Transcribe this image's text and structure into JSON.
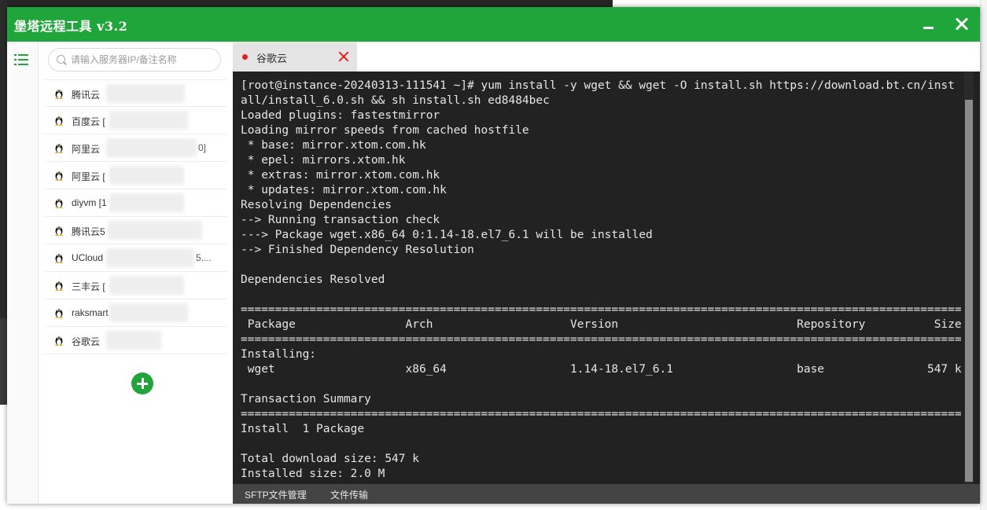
{
  "window": {
    "title": "堡塔远程工具 v3.2",
    "accent_color": "#20a53a"
  },
  "sidebar": {
    "menu_icon": "list-icon",
    "search": {
      "placeholder": "请输入服务器IP/备注名称",
      "value": ""
    },
    "servers": [
      {
        "name": "腾讯云",
        "tail": ""
      },
      {
        "name": "百度云 [",
        "tail": ""
      },
      {
        "name": "阿里云",
        "tail": "0]"
      },
      {
        "name": "阿里云 [",
        "tail": ""
      },
      {
        "name": "diyvm [1",
        "tail": ""
      },
      {
        "name": "腾讯云5",
        "tail": ""
      },
      {
        "name": "UCloud",
        "tail": "5...."
      },
      {
        "name": "三丰云 [",
        "tail": ""
      },
      {
        "name": "raksmart",
        "tail": ""
      },
      {
        "name": "谷歌云",
        "tail": ""
      }
    ],
    "server_icon": "linux-penguin-icon",
    "add_button_icon": "plus-icon"
  },
  "tabs": [
    {
      "label": "谷歌云",
      "status_color": "#e02020",
      "active": true
    }
  ],
  "terminal": {
    "lines": [
      "[root@instance-20240313-111541 ~]# yum install -y wget && wget -O install.sh https://download.bt.cn/inst",
      "all/install_6.0.sh && sh install.sh ed8484bec",
      "Loaded plugins: fastestmirror",
      "Loading mirror speeds from cached hostfile",
      " * base: mirror.xtom.com.hk",
      " * epel: mirrors.xtom.hk",
      " * extras: mirror.xtom.com.hk",
      " * updates: mirror.xtom.com.hk",
      "Resolving Dependencies",
      "--> Running transaction check",
      "---> Package wget.x86_64 0:1.14-18.el7_6.1 will be installed",
      "--> Finished Dependency Resolution",
      "",
      "Dependencies Resolved",
      "",
      "=========================================================================================================",
      " Package                Arch                    Version                          Repository          Size",
      "=========================================================================================================",
      "Installing:",
      " wget                   x86_64                  1.14-18.el7_6.1                  base               547 k",
      "",
      "Transaction Summary",
      "=========================================================================================================",
      "Install  1 Package",
      "",
      "Total download size: 547 k",
      "Installed size: 2.0 M"
    ]
  },
  "bottom_toolbar": {
    "sftp_label": "SFTP文件管理",
    "transfer_label": "文件传输"
  }
}
